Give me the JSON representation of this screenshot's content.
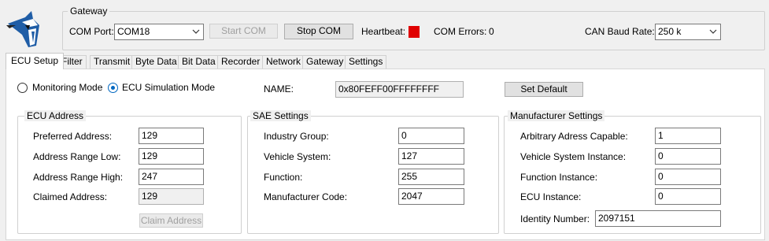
{
  "gateway": {
    "title": "Gateway",
    "com_port_label": "COM Port:",
    "com_port_value": "COM18",
    "start_com_label": "Start COM",
    "stop_com_label": "Stop COM",
    "heartbeat_label": "Heartbeat:",
    "heartbeat_color": "#e00000",
    "com_errors_label": "COM Errors:",
    "com_errors_value": "0",
    "baud_label": "CAN Baud Rate:",
    "baud_value": "250 k"
  },
  "tabs": [
    {
      "label": "ECU Setup"
    },
    {
      "label": "Filter"
    },
    {
      "label": "Transmit"
    },
    {
      "label": "Byte Data"
    },
    {
      "label": "Bit Data"
    },
    {
      "label": "Recorder"
    },
    {
      "label": "Network"
    },
    {
      "label": "Gateway"
    },
    {
      "label": "Settings"
    }
  ],
  "mode": {
    "monitoring_label": "Monitoring Mode",
    "ecu_sim_label": "ECU Simulation Mode",
    "selected": "ECU Simulation Mode",
    "name_label": "NAME:",
    "name_value": "0x80FEFF00FFFFFFFF",
    "set_default_label": "Set Default"
  },
  "ecu_address": {
    "title": "ECU Address",
    "preferred_label": "Preferred Address:",
    "preferred_value": "129",
    "range_low_label": "Address Range Low:",
    "range_low_value": "129",
    "range_high_label": "Address Range High:",
    "range_high_value": "247",
    "claimed_label": "Claimed Address:",
    "claimed_value": "129",
    "claim_button_label": "Claim Address"
  },
  "sae": {
    "title": "SAE Settings",
    "industry_group_label": "Industry Group:",
    "industry_group_value": "0",
    "vehicle_system_label": "Vehicle System:",
    "vehicle_system_value": "127",
    "function_label": "Function:",
    "function_value": "255",
    "manufacturer_code_label": "Manufacturer Code:",
    "manufacturer_code_value": "2047"
  },
  "manufacturer": {
    "title": "Manufacturer Settings",
    "arbitrary_label": "Arbitrary Adress Capable:",
    "arbitrary_value": "1",
    "vsi_label": "Vehicle System Instance:",
    "vsi_value": "0",
    "function_instance_label": "Function Instance:",
    "function_instance_value": "0",
    "ecu_instance_label": "ECU Instance:",
    "ecu_instance_value": "0",
    "identity_label": "Identity Number:",
    "identity_value": "2097151"
  }
}
